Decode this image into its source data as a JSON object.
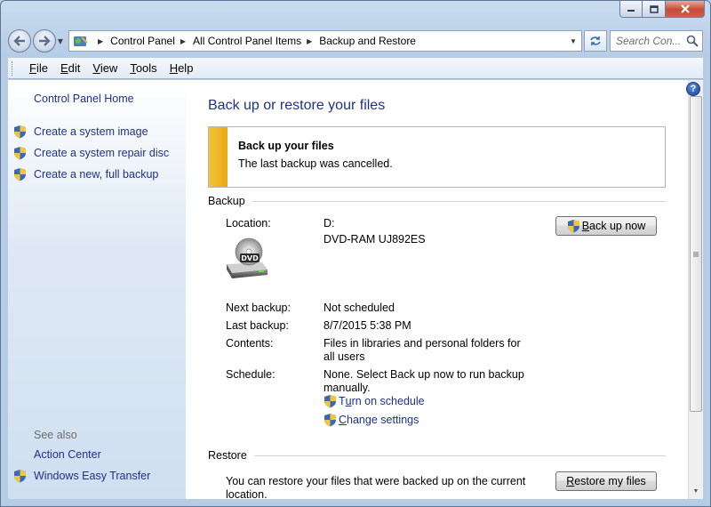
{
  "window": {
    "caption": {
      "minimize": "minimize",
      "maximize": "maximize",
      "close": "close"
    }
  },
  "address_bar": {
    "crumbs": [
      "Control Panel",
      "All Control Panel Items",
      "Backup and Restore"
    ],
    "search_placeholder": "Search Con..."
  },
  "menu": [
    {
      "label": "File",
      "access": "F",
      "rest": "ile"
    },
    {
      "label": "Edit",
      "access": "E",
      "rest": "dit"
    },
    {
      "label": "View",
      "access": "V",
      "rest": "iew"
    },
    {
      "label": "Tools",
      "access": "T",
      "rest": "ools"
    },
    {
      "label": "Help",
      "access": "H",
      "rest": "elp"
    }
  ],
  "sidebar": {
    "home": "Control Panel Home",
    "tasks": [
      "Create a system image",
      "Create a system repair disc",
      "Create a new, full backup"
    ],
    "see_also_label": "See also",
    "see_also": [
      "Action Center",
      "Windows Easy Transfer"
    ]
  },
  "main": {
    "title": "Back up or restore your files",
    "notice": {
      "title": "Back up your files",
      "message": "The last backup was cancelled."
    },
    "backup": {
      "heading": "Backup",
      "location_label": "Location:",
      "location_drive": "D:",
      "location_device": "DVD-RAM UJ892ES",
      "dvd_badge": "DVD",
      "backup_now_access": "B",
      "backup_now_rest": "ack up now",
      "next_backup_label": "Next backup:",
      "next_backup_value": "Not scheduled",
      "last_backup_label": "Last backup:",
      "last_backup_value": "8/7/2015 5:38 PM",
      "contents_label": "Contents:",
      "contents_value": "Files in libraries and personal folders for all users",
      "schedule_label": "Schedule:",
      "schedule_value": "None. Select Back up now to run backup manually.",
      "turn_on_schedule_prefix": "T",
      "turn_on_schedule_access": "u",
      "turn_on_schedule_rest": "rn on schedule",
      "change_settings_access": "C",
      "change_settings_rest": "hange settings"
    },
    "restore": {
      "heading": "Restore",
      "message": "You can restore your files that were backed up on the current location.",
      "button_access": "R",
      "button_rest": "estore my files"
    }
  },
  "colors": {
    "link": "#1e3287",
    "notice_bar": "#f3c33a",
    "title": "#1e3287"
  },
  "icons": [
    "back-arrow-icon",
    "forward-arrow-icon",
    "control-panel-icon",
    "refresh-icon",
    "search-icon",
    "help-icon",
    "uac-shield-icon",
    "dvd-drive-icon"
  ]
}
